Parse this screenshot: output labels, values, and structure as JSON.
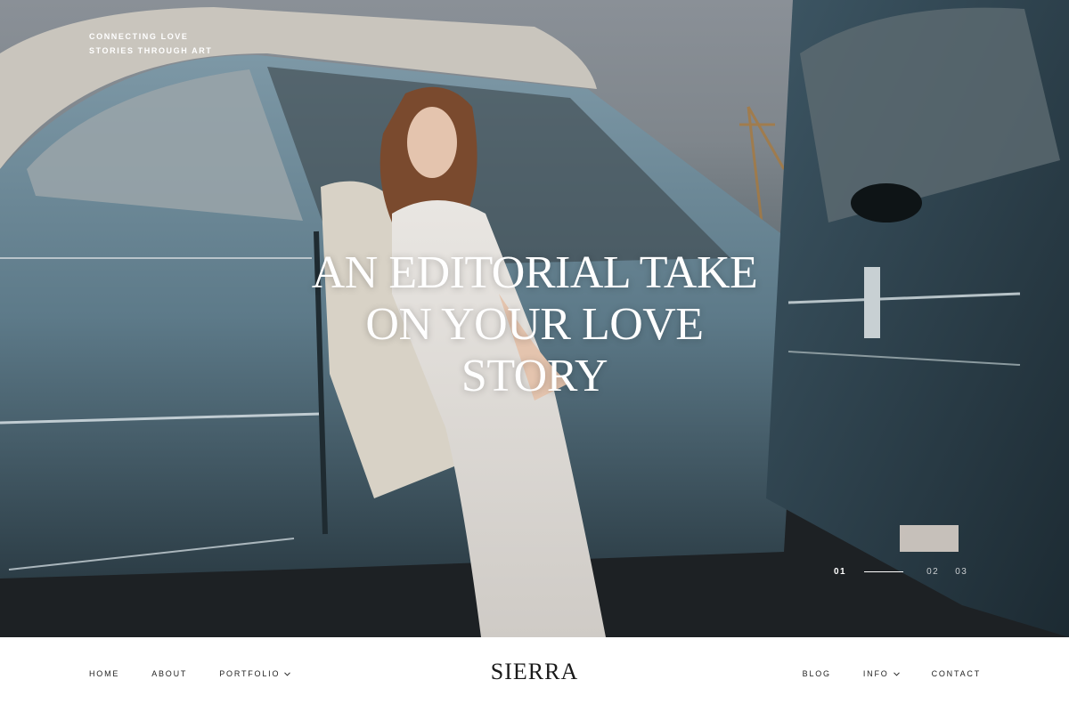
{
  "hero": {
    "tagline": [
      "CONNECTING LOVE",
      "STORIES THROUGH ART"
    ],
    "headline": [
      "AN EDITORIAL TAKE",
      "ON YOUR LOVE",
      "STORY"
    ],
    "slider": {
      "slides": [
        "01",
        "02",
        "03"
      ],
      "active_index": 0
    }
  },
  "nav": {
    "logo": "SIERRA",
    "left": [
      {
        "label": "HOME",
        "has_dropdown": false
      },
      {
        "label": "ABOUT",
        "has_dropdown": false
      },
      {
        "label": "PORTFOLIO",
        "has_dropdown": true
      }
    ],
    "right": [
      {
        "label": "BLOG",
        "has_dropdown": false
      },
      {
        "label": "INFO",
        "has_dropdown": true
      },
      {
        "label": "CONTACT",
        "has_dropdown": false
      }
    ]
  },
  "icons": {
    "dropdown": "chevron-down-icon"
  },
  "colors": {
    "car_blue": "#6f8d9c",
    "nav_text": "#222222",
    "background": "#ffffff"
  }
}
